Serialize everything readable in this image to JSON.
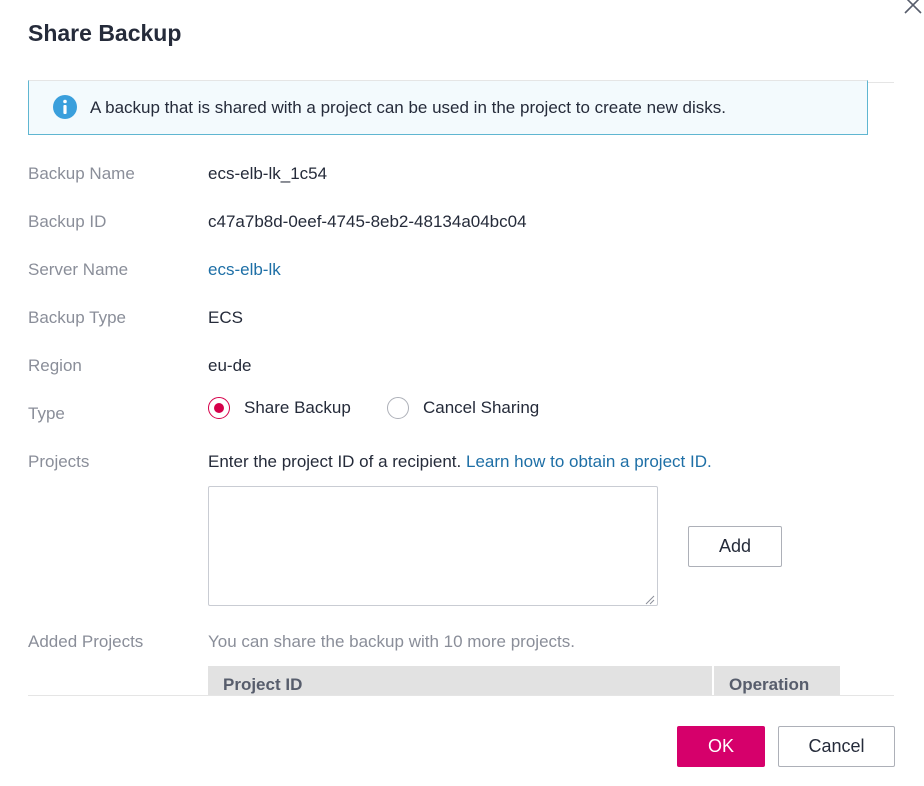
{
  "dialog": {
    "title": "Share Backup",
    "close_icon": "close-icon"
  },
  "info": {
    "icon": "info-icon",
    "text": "A backup that is shared with a project can be used in the project to create new disks."
  },
  "fields": {
    "backup_name": {
      "label": "Backup Name",
      "value": "ecs-elb-lk_1c54"
    },
    "backup_id": {
      "label": "Backup ID",
      "value": "c47a7b8d-0eef-4745-8eb2-48134a04bc04"
    },
    "server_name": {
      "label": "Server Name",
      "value": "ecs-elb-lk"
    },
    "backup_type": {
      "label": "Backup Type",
      "value": "ECS"
    },
    "region": {
      "label": "Region",
      "value": "eu-de"
    },
    "type": {
      "label": "Type",
      "options": [
        {
          "label": "Share Backup",
          "selected": true
        },
        {
          "label": "Cancel Sharing",
          "selected": false
        }
      ]
    },
    "projects": {
      "label": "Projects",
      "instruction": "Enter the project ID of a recipient.",
      "link": "Learn how to obtain a project ID.",
      "input_value": "",
      "add_label": "Add"
    },
    "added_projects": {
      "label": "Added Projects",
      "hint": "You can share the backup with 10 more projects.",
      "columns": [
        "Project ID",
        "Operation"
      ]
    }
  },
  "footer": {
    "ok_label": "OK",
    "cancel_label": "Cancel"
  },
  "colors": {
    "accent": "#d6006b",
    "link": "#1e6fa6",
    "info_border": "#5fb6d1",
    "info_icon": "#3a9fdc"
  }
}
